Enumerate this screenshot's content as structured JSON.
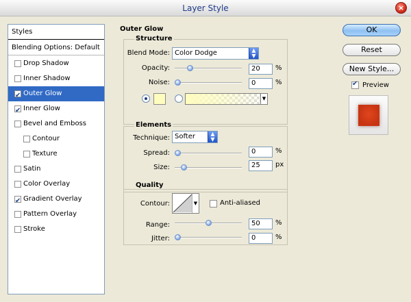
{
  "window": {
    "title": "Layer Style"
  },
  "styles_list": {
    "header": "Styles",
    "blending_options": "Blending Options: Default",
    "items": [
      {
        "label": "Drop Shadow",
        "checked": false,
        "selected": false,
        "indent": false
      },
      {
        "label": "Inner Shadow",
        "checked": false,
        "selected": false,
        "indent": false
      },
      {
        "label": "Outer Glow",
        "checked": true,
        "selected": true,
        "indent": false
      },
      {
        "label": "Inner Glow",
        "checked": true,
        "selected": false,
        "indent": false
      },
      {
        "label": "Bevel and Emboss",
        "checked": false,
        "selected": false,
        "indent": false
      },
      {
        "label": "Contour",
        "checked": false,
        "selected": false,
        "indent": true
      },
      {
        "label": "Texture",
        "checked": false,
        "selected": false,
        "indent": true
      },
      {
        "label": "Satin",
        "checked": false,
        "selected": false,
        "indent": false
      },
      {
        "label": "Color Overlay",
        "checked": false,
        "selected": false,
        "indent": false
      },
      {
        "label": "Gradient Overlay",
        "checked": true,
        "selected": false,
        "indent": false
      },
      {
        "label": "Pattern Overlay",
        "checked": false,
        "selected": false,
        "indent": false
      },
      {
        "label": "Stroke",
        "checked": false,
        "selected": false,
        "indent": false
      }
    ]
  },
  "outer_glow": {
    "title": "Outer Glow",
    "structure": {
      "title": "Structure",
      "blend_mode_label": "Blend Mode:",
      "blend_mode_value": "Color Dodge",
      "opacity_label": "Opacity:",
      "opacity_value": "20",
      "opacity_level": 20,
      "noise_label": "Noise:",
      "noise_value": "0",
      "noise_level": 0,
      "percent": "%",
      "color": "#fffdbe"
    },
    "elements": {
      "title": "Elements",
      "technique_label": "Technique:",
      "technique_value": "Softer",
      "spread_label": "Spread:",
      "spread_value": "0",
      "spread_level": 0,
      "size_label": "Size:",
      "size_value": "25",
      "size_level": 10,
      "percent": "%",
      "px": "px"
    },
    "quality": {
      "title": "Quality",
      "contour_label": "Contour:",
      "anti_aliased_label": "Anti-aliased",
      "anti_aliased": false,
      "range_label": "Range:",
      "range_value": "50",
      "range_level": 50,
      "jitter_label": "Jitter:",
      "jitter_value": "0",
      "jitter_level": 0,
      "percent": "%"
    }
  },
  "buttons": {
    "ok": "OK",
    "reset": "Reset",
    "new_style": "New Style...",
    "preview": "Preview",
    "preview_checked": true
  },
  "colors": {
    "selection": "#316ac5",
    "preview_swatch": "#c73412"
  }
}
